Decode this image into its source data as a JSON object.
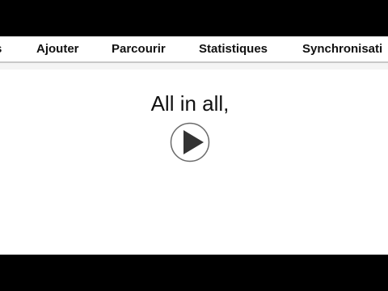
{
  "menu": {
    "items": [
      {
        "label": "s"
      },
      {
        "label": "Ajouter"
      },
      {
        "label": "Parcourir"
      },
      {
        "label": "Statistiques"
      },
      {
        "label": "Synchronisati"
      }
    ]
  },
  "card": {
    "question_text": "All in all,",
    "audio_icon": "play-icon"
  },
  "colors": {
    "letterbox": "#000000",
    "background": "#ffffff",
    "text": "#111111",
    "icon": "#333333"
  }
}
